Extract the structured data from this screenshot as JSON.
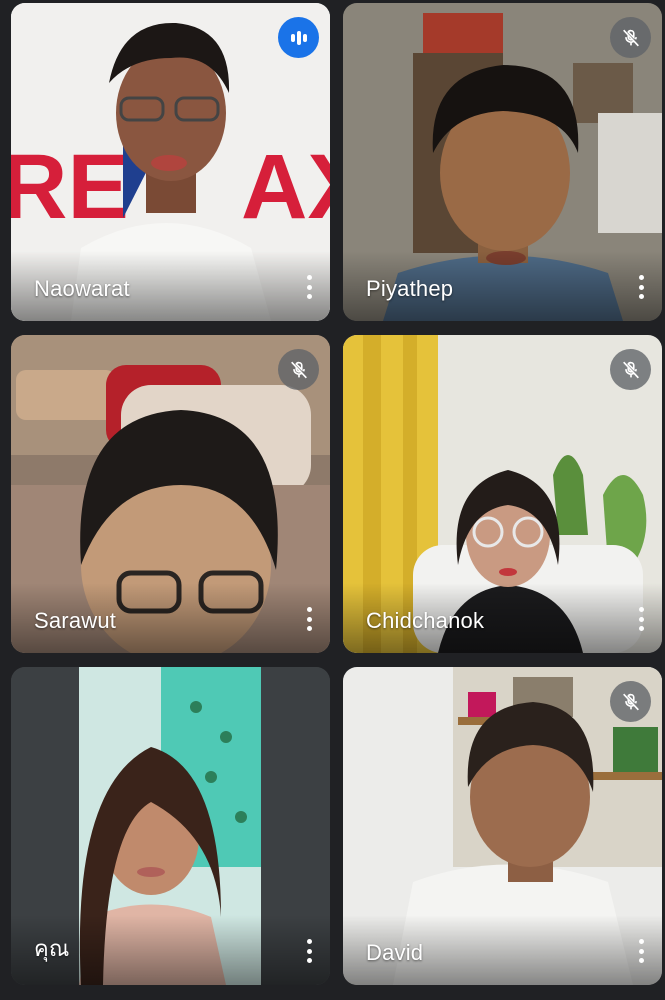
{
  "participants": [
    {
      "name": "Naowarat",
      "status": "speaking",
      "status_icon": "audio-level-icon"
    },
    {
      "name": "Piyathep",
      "status": "muted",
      "status_icon": "mic-off-icon"
    },
    {
      "name": "Sarawut",
      "status": "muted",
      "status_icon": "mic-off-icon"
    },
    {
      "name": "Chidchanok",
      "status": "muted",
      "status_icon": "mic-off-icon"
    },
    {
      "name": "คุณ",
      "status": "self",
      "status_icon": ""
    },
    {
      "name": "David",
      "status": "muted",
      "status_icon": "mic-off-icon"
    }
  ],
  "colors": {
    "background": "#202124",
    "speaking_badge": "#1a73e8",
    "muted_badge": "#5f6368",
    "name_text": "#ffffff"
  }
}
